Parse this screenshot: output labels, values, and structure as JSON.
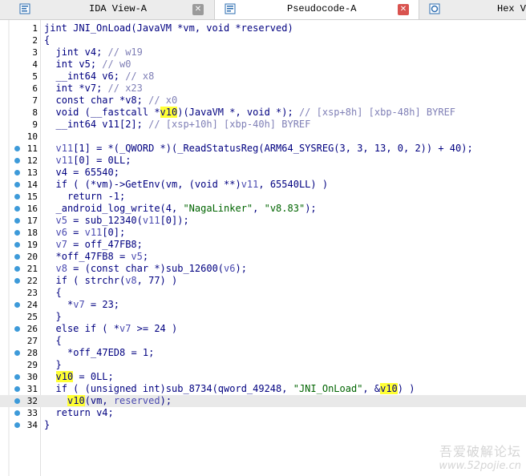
{
  "tabs": [
    {
      "label": "IDA View-A",
      "active": false,
      "icon": "ida-view-icon",
      "close": true
    },
    {
      "label": "Pseudocode-A",
      "active": true,
      "icon": "pseudocode-icon",
      "close": true
    },
    {
      "label": "Hex Vi",
      "active": false,
      "icon": "hex-view-icon",
      "close": false
    }
  ],
  "colors": {
    "keyword": "#000080",
    "comment": "#7f7fb6",
    "string": "#006400",
    "highlight": "#ffff33",
    "close_active": "#d9534f",
    "close_inactive": "#9a9a9a",
    "dot": "#3d9ad9"
  },
  "current_line": 32,
  "code": [
    {
      "n": 1,
      "dot": false,
      "indent": 0,
      "tokens": [
        [
          "k",
          "jint "
        ],
        [
          "f",
          "JNI_OnLoad"
        ],
        [
          "k",
          "(JavaVM *vm, void *reserved)"
        ]
      ]
    },
    {
      "n": 2,
      "dot": false,
      "indent": 0,
      "tokens": [
        [
          "k",
          "{"
        ]
      ]
    },
    {
      "n": 3,
      "dot": false,
      "indent": 1,
      "tokens": [
        [
          "k",
          "jint v4; "
        ],
        [
          "c",
          "// w19"
        ]
      ]
    },
    {
      "n": 4,
      "dot": false,
      "indent": 1,
      "tokens": [
        [
          "k",
          "int v5; "
        ],
        [
          "c",
          "// w0"
        ]
      ]
    },
    {
      "n": 5,
      "dot": false,
      "indent": 1,
      "tokens": [
        [
          "k",
          "__int64 v6; "
        ],
        [
          "c",
          "// x8"
        ]
      ]
    },
    {
      "n": 6,
      "dot": false,
      "indent": 1,
      "tokens": [
        [
          "k",
          "int *v7; "
        ],
        [
          "c",
          "// x23"
        ]
      ]
    },
    {
      "n": 7,
      "dot": false,
      "indent": 1,
      "tokens": [
        [
          "k",
          "const char *v8; "
        ],
        [
          "c",
          "// x0"
        ]
      ]
    },
    {
      "n": 8,
      "dot": false,
      "indent": 1,
      "tokens": [
        [
          "k",
          "void (__fastcall *"
        ],
        [
          "h",
          "v10"
        ],
        [
          "k",
          ")(JavaVM *, void *); "
        ],
        [
          "c",
          "// [xsp+8h] [xbp-48h] BYREF"
        ]
      ]
    },
    {
      "n": 9,
      "dot": false,
      "indent": 1,
      "tokens": [
        [
          "k",
          "__int64 v11[2]; "
        ],
        [
          "c",
          "// [xsp+10h] [xbp-40h] BYREF"
        ]
      ]
    },
    {
      "n": 10,
      "dot": false,
      "indent": 0,
      "tokens": []
    },
    {
      "n": 11,
      "dot": true,
      "indent": 1,
      "tokens": [
        [
          "v",
          "v11"
        ],
        [
          "k",
          "[1] = *(_QWORD *)(_ReadStatusReg(ARM64_SYSREG(3, 3, 13, 0, 2)) + 40);"
        ]
      ]
    },
    {
      "n": 12,
      "dot": true,
      "indent": 1,
      "tokens": [
        [
          "v",
          "v11"
        ],
        [
          "k",
          "[0] = 0LL;"
        ]
      ]
    },
    {
      "n": 13,
      "dot": true,
      "indent": 1,
      "tokens": [
        [
          "k",
          "v4 = 65540;"
        ]
      ]
    },
    {
      "n": 14,
      "dot": true,
      "indent": 1,
      "tokens": [
        [
          "k",
          "if ( (*vm)->GetEnv(vm, (void **)"
        ],
        [
          "v",
          "v11"
        ],
        [
          "k",
          ", 65540LL) )"
        ]
      ]
    },
    {
      "n": 15,
      "dot": true,
      "indent": 2,
      "tokens": [
        [
          "k",
          "return -1;"
        ]
      ]
    },
    {
      "n": 16,
      "dot": true,
      "indent": 1,
      "tokens": [
        [
          "k",
          "_android_log_write(4, "
        ],
        [
          "s",
          "\"NagaLinker\""
        ],
        [
          "k",
          ", "
        ],
        [
          "s",
          "\"v8.83\""
        ],
        [
          "k",
          ");"
        ]
      ]
    },
    {
      "n": 17,
      "dot": true,
      "indent": 1,
      "tokens": [
        [
          "v",
          "v5"
        ],
        [
          "k",
          " = sub_12340("
        ],
        [
          "v",
          "v11"
        ],
        [
          "k",
          "[0]);"
        ]
      ]
    },
    {
      "n": 18,
      "dot": true,
      "indent": 1,
      "tokens": [
        [
          "v",
          "v6"
        ],
        [
          "k",
          " = "
        ],
        [
          "v",
          "v11"
        ],
        [
          "k",
          "[0];"
        ]
      ]
    },
    {
      "n": 19,
      "dot": true,
      "indent": 1,
      "tokens": [
        [
          "v",
          "v7"
        ],
        [
          "k",
          " = off_47FB8;"
        ]
      ]
    },
    {
      "n": 20,
      "dot": true,
      "indent": 1,
      "tokens": [
        [
          "k",
          "*off_47FB8 = "
        ],
        [
          "v",
          "v5"
        ],
        [
          "k",
          ";"
        ]
      ]
    },
    {
      "n": 21,
      "dot": true,
      "indent": 1,
      "tokens": [
        [
          "v",
          "v8"
        ],
        [
          "k",
          " = (const char *)sub_12600("
        ],
        [
          "v",
          "v6"
        ],
        [
          "k",
          ");"
        ]
      ]
    },
    {
      "n": 22,
      "dot": true,
      "indent": 1,
      "tokens": [
        [
          "k",
          "if ( strchr("
        ],
        [
          "v",
          "v8"
        ],
        [
          "k",
          ", 77) )"
        ]
      ]
    },
    {
      "n": 23,
      "dot": false,
      "indent": 1,
      "tokens": [
        [
          "k",
          "{"
        ]
      ]
    },
    {
      "n": 24,
      "dot": true,
      "indent": 2,
      "tokens": [
        [
          "k",
          "*"
        ],
        [
          "v",
          "v7"
        ],
        [
          "k",
          " = 23;"
        ]
      ]
    },
    {
      "n": 25,
      "dot": false,
      "indent": 1,
      "tokens": [
        [
          "k",
          "}"
        ]
      ]
    },
    {
      "n": 26,
      "dot": true,
      "indent": 1,
      "tokens": [
        [
          "k",
          "else if ( *"
        ],
        [
          "v",
          "v7"
        ],
        [
          "k",
          " >= 24 )"
        ]
      ]
    },
    {
      "n": 27,
      "dot": false,
      "indent": 1,
      "tokens": [
        [
          "k",
          "{"
        ]
      ]
    },
    {
      "n": 28,
      "dot": true,
      "indent": 2,
      "tokens": [
        [
          "k",
          "*off_47ED8 = 1;"
        ]
      ]
    },
    {
      "n": 29,
      "dot": false,
      "indent": 1,
      "tokens": [
        [
          "k",
          "}"
        ]
      ]
    },
    {
      "n": 30,
      "dot": true,
      "indent": 1,
      "tokens": [
        [
          "h",
          "v10"
        ],
        [
          "k",
          " = 0LL;"
        ]
      ]
    },
    {
      "n": 31,
      "dot": true,
      "indent": 1,
      "tokens": [
        [
          "k",
          "if ( (unsigned int)sub_8734(qword_49248, "
        ],
        [
          "s",
          "\"JNI_OnLoad\""
        ],
        [
          "k",
          ", &"
        ],
        [
          "h",
          "v10"
        ],
        [
          "k",
          ") )"
        ]
      ]
    },
    {
      "n": 32,
      "dot": true,
      "indent": 2,
      "tokens": [
        [
          "h",
          "v10"
        ],
        [
          "k",
          "(vm, "
        ],
        [
          "v",
          "reserved"
        ],
        [
          "k",
          ");"
        ]
      ]
    },
    {
      "n": 33,
      "dot": true,
      "indent": 1,
      "tokens": [
        [
          "k",
          "return v4;"
        ]
      ]
    },
    {
      "n": 34,
      "dot": true,
      "indent": 0,
      "tokens": [
        [
          "k",
          "}"
        ]
      ]
    }
  ],
  "watermark": {
    "line1": "吾爱破解论坛",
    "line2": "www.52pojie.cn"
  }
}
